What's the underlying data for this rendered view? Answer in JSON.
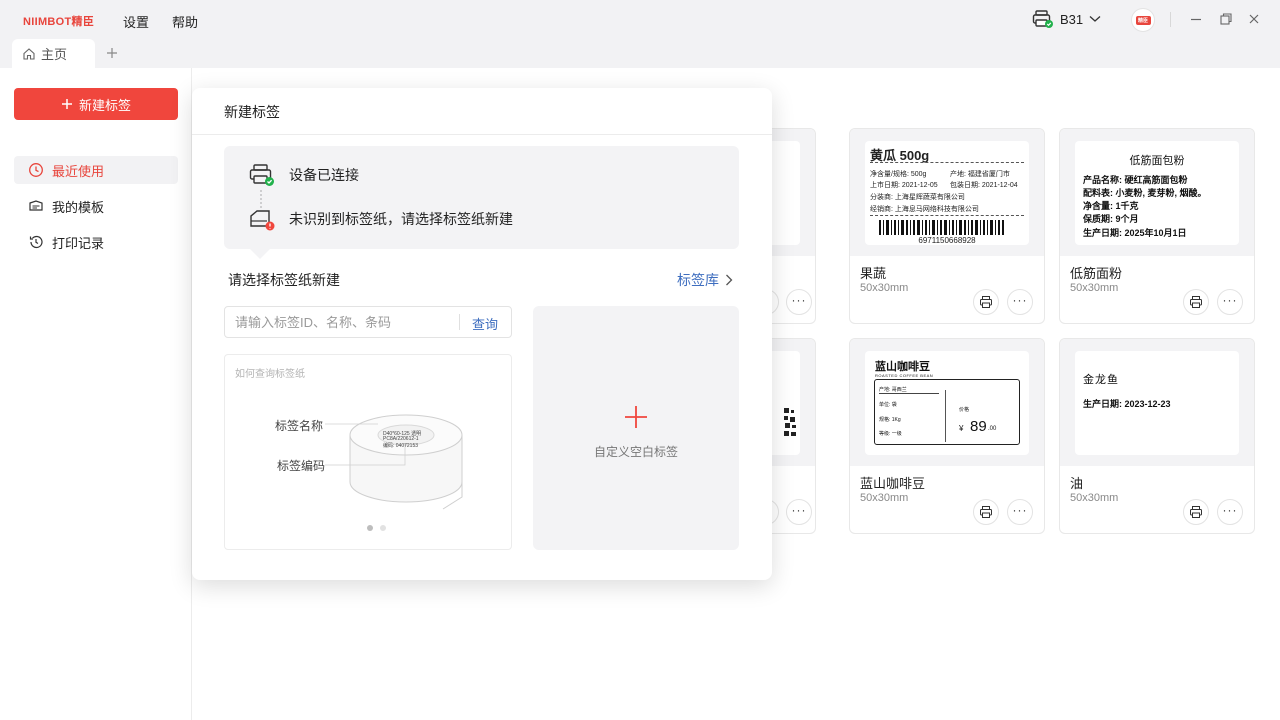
{
  "app": {
    "logo_text": "NIIMBOT精臣"
  },
  "menu": {
    "settings": "设置",
    "help": "帮助"
  },
  "printer": {
    "name": "B31",
    "icon": "printer-connected-icon"
  },
  "avatar": {
    "text": "精臣"
  },
  "tabs": [
    {
      "label": "主页"
    }
  ],
  "sidebar": {
    "new_button": "新建标签",
    "items": [
      {
        "label": "最近使用",
        "icon": "clock-icon",
        "active": true
      },
      {
        "label": "我的模板",
        "icon": "template-icon",
        "active": false
      },
      {
        "label": "打印记录",
        "icon": "history-icon",
        "active": false
      }
    ]
  },
  "cards": [
    {
      "name": "果蔬",
      "size": "50x30mm",
      "label": {
        "title": "黄瓜 500g",
        "line1_a": "净含量/规格: 500g",
        "line1_b": "产地: 福建省厦门市",
        "line2_a": "上市日期: 2021-12-05",
        "line2_b": "包装日期: 2021-12-04",
        "line3": "分装商: 上海星辉蔬菜有限公司",
        "line4": "经销商: 上海息马网络科技有限公司",
        "barcode": "6971150668928"
      }
    },
    {
      "name": "低筋面粉",
      "size": "50x30mm",
      "label": {
        "title": "低筋面包粉",
        "line1": "产品名称: 硬红高筋面包粉",
        "line2": "配料表: 小麦粉, 麦芽粉, 烟酸。",
        "line3": "净含量: 1千克",
        "line4": "保质期: 9个月",
        "line5": "生产日期: 2025年10月1日"
      }
    },
    {
      "name": "蓝山咖啡豆",
      "size": "50x30mm",
      "label": {
        "title": "蓝山咖啡豆",
        "subtitle": "ROASTED COFFEE BEAN",
        "origin": "产地: 哥西兰",
        "unit": "单位: 袋",
        "spec": "规格: 1Kg",
        "grade": "等级: 一级",
        "price_label": "价格",
        "currency": "¥",
        "price_int": "89",
        "price_dec": ".00"
      }
    },
    {
      "name": "油",
      "size": "50x30mm",
      "label": {
        "title": "金龙鱼",
        "date": "生产日期: 2023-12-23"
      }
    }
  ],
  "popover": {
    "title": "新建标签",
    "status_connected": "设备已连接",
    "status_no_paper": "未识别到标签纸，请选择标签纸新建",
    "choose_title": "请选择标签纸新建",
    "library_link": "标签库",
    "search_placeholder": "请输入标签ID、名称、条码",
    "search_button": "查询",
    "help_title": "如何查询标签纸",
    "help_label_name": "标签名称",
    "help_label_code": "标签编码",
    "roll_text_1": "D40*60-125 透明",
    "roll_text_2": "PC8A/220612-1",
    "roll_text_3": "编码: 04072153",
    "custom_label": "自定义空白标签"
  },
  "colors": {
    "accent": "#f0463d",
    "link": "#3d6dbf"
  }
}
